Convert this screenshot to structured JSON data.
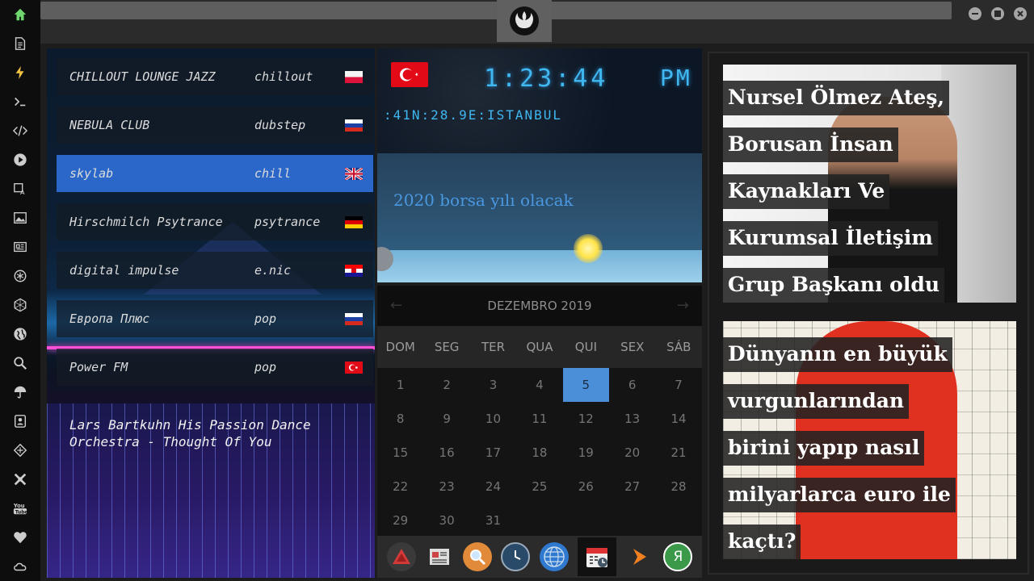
{
  "app": {
    "emblem": "rebel-alliance-icon",
    "accent": "#3fb7f0"
  },
  "window": {
    "controls": [
      "minimize",
      "maximize",
      "close"
    ]
  },
  "sidebar": {
    "icons": [
      "home-icon",
      "document-icon",
      "bolt-icon",
      "terminal-icon",
      "code-icon",
      "play-icon",
      "translate-icon",
      "image-icon",
      "news-icon",
      "settings-icon",
      "hexagon-icon",
      "globe-icon",
      "search-icon",
      "umbrella-icon",
      "contacts-icon",
      "network-icon",
      "tools-icon",
      "youtube-icon",
      "heart-icon",
      "cloud-icon"
    ]
  },
  "radio": {
    "stations": [
      {
        "name": "CHILLOUT LOUNGE JAZZ",
        "genre": "chillout",
        "flag": "pl"
      },
      {
        "name": "NEBULA CLUB",
        "genre": "dubstep",
        "flag": "ru"
      },
      {
        "name": "skylab",
        "genre": "chill",
        "flag": "gb"
      },
      {
        "name": "Hirschmilch Psytrance",
        "genre": "psytrance",
        "flag": "de"
      },
      {
        "name": "digital impulse",
        "genre": "e.nic",
        "flag": "hr"
      },
      {
        "name": "Европа Плюс",
        "genre": "pop",
        "flag": "ru"
      },
      {
        "name": "Power FM",
        "genre": "pop",
        "flag": "tr"
      }
    ],
    "active_index": 2,
    "now_playing": "Lars Bartkuhn His Passion Dance Orchestra - Thought Of You"
  },
  "clock": {
    "time": "1:23:44",
    "ampm": "PM",
    "location": ":41N:28.9E:ISTANBUL",
    "flag": "tr",
    "headline": "2020 borsa yılı olacak"
  },
  "calendar": {
    "month": "DEZEMBRO 2019",
    "weekdays": [
      "DOM",
      "SEG",
      "TER",
      "QUA",
      "QUI",
      "SEX",
      "SÁB"
    ],
    "days": [
      "1",
      "2",
      "3",
      "4",
      "5",
      "6",
      "7",
      "8",
      "9",
      "10",
      "11",
      "12",
      "13",
      "14",
      "15",
      "16",
      "17",
      "18",
      "19",
      "20",
      "21",
      "22",
      "23",
      "24",
      "25",
      "26",
      "27",
      "28",
      "29",
      "30",
      "31"
    ],
    "today": "5"
  },
  "dock": {
    "apps": [
      "arrow-up-icon",
      "news-reader-icon",
      "search-icon",
      "clock-icon",
      "globe-icon",
      "calendar-icon",
      "play-arrow-icon",
      "yandex-icon"
    ],
    "selected": 5
  },
  "news": [
    {
      "headline": "Nursel Ölmez Ateş, Borusan İnsan Kaynakları Ve Kurumsal İletişim Grup Başkanı oldu"
    },
    {
      "headline": "Dünyanın en büyük vurgunlarından birini yapıp nasıl milyarlarca euro ile kaçtı?"
    }
  ]
}
